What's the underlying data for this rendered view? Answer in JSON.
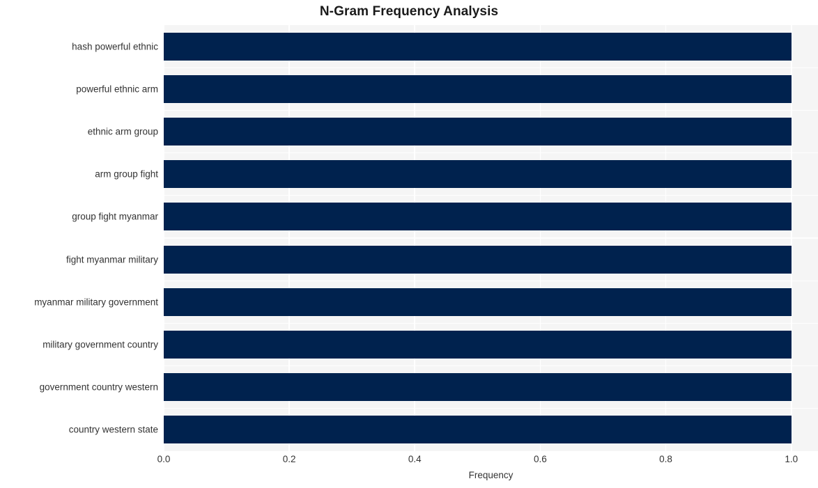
{
  "chart_data": {
    "type": "bar",
    "orientation": "horizontal",
    "title": "N-Gram Frequency Analysis",
    "xlabel": "Frequency",
    "ylabel": "",
    "categories": [
      "hash powerful ethnic",
      "powerful ethnic arm",
      "ethnic arm group",
      "arm group fight",
      "group fight myanmar",
      "fight myanmar military",
      "myanmar military government",
      "military government country",
      "government country western",
      "country western state"
    ],
    "values": [
      1.0,
      1.0,
      1.0,
      1.0,
      1.0,
      1.0,
      1.0,
      1.0,
      1.0,
      1.0
    ],
    "xlim": [
      0.0,
      1.0425
    ],
    "xticks": [
      0.0,
      0.2,
      0.4,
      0.6,
      0.8,
      1.0
    ],
    "xtick_labels": [
      "0.0",
      "0.2",
      "0.4",
      "0.6",
      "0.8",
      "1.0"
    ],
    "grid": true,
    "legend": null,
    "bar_color": "#00224e",
    "plot_background": "#f5f5f5",
    "gridline_color": "#ffffff",
    "figure_background": "#ffffff",
    "text_color": "#333333",
    "title_color": "#1a1a1a"
  }
}
